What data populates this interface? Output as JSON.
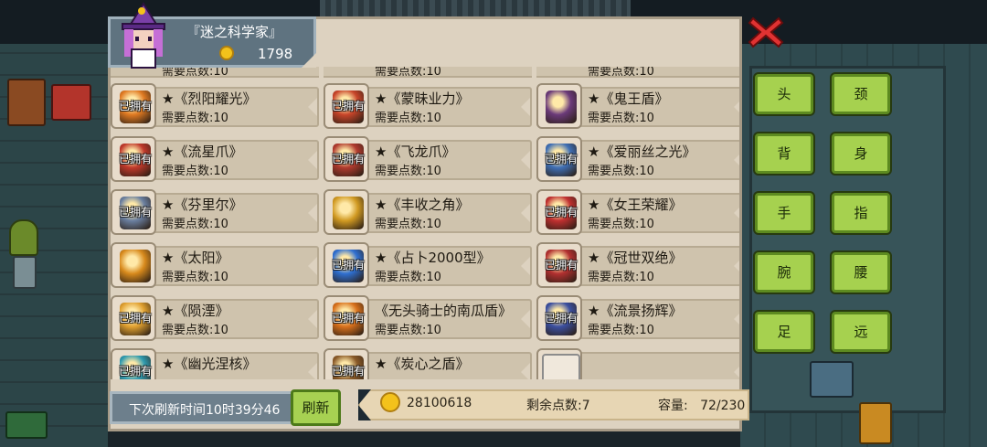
{
  "header": {
    "title": "『迷之科学家』",
    "coins": "1798",
    "avatar_icon": "wizard-avatar-icon"
  },
  "close_icon": "close-x-icon",
  "owned_label": "已拥有",
  "partial_top": [
    "需要点数:10",
    "需要点数:10",
    "需要点数:10"
  ],
  "items": [
    {
      "name": "★《烈阳耀光》",
      "cost": "需要点数:10",
      "owned": true,
      "icon": "flame-spear-icon",
      "color": "#e07a22"
    },
    {
      "name": "★《蒙昧业力》",
      "cost": "需要点数:10",
      "owned": true,
      "icon": "fire-staff-icon",
      "color": "#c8452a"
    },
    {
      "name": "★《鬼王盾》",
      "cost": "需要点数:10",
      "owned": false,
      "icon": "demon-shield-icon",
      "color": "#6b3a7a"
    },
    {
      "name": "★《流星爪》",
      "cost": "需要点数:10",
      "owned": true,
      "icon": "meteor-claw-icon",
      "color": "#c0392b"
    },
    {
      "name": "★《飞龙爪》",
      "cost": "需要点数:10",
      "owned": true,
      "icon": "dragon-claw-icon",
      "color": "#b03a2e"
    },
    {
      "name": "★《爱丽丝之光》",
      "cost": "需要点数:10",
      "owned": true,
      "icon": "alice-light-icon",
      "color": "#3f6fb5"
    },
    {
      "name": "★《芬里尔》",
      "cost": "需要点数:10",
      "owned": true,
      "icon": "wolf-gauntlet-icon",
      "color": "#6a7fa0"
    },
    {
      "name": "★《丰收之角》",
      "cost": "需要点数:10",
      "owned": false,
      "icon": "horn-icon",
      "color": "#d19a22"
    },
    {
      "name": "★《女王荣耀》",
      "cost": "需要点数:10",
      "owned": true,
      "icon": "queen-shield-icon",
      "color": "#c03030"
    },
    {
      "name": "★《太阳》",
      "cost": "需要点数:10",
      "owned": false,
      "icon": "sun-shield-icon",
      "color": "#d88a1c"
    },
    {
      "name": "★《占卜2000型》",
      "cost": "需要点数:10",
      "owned": true,
      "icon": "crystal-ball-icon",
      "color": "#2e6fd1"
    },
    {
      "name": "★《冠世双绝》",
      "cost": "需要点数:10",
      "owned": true,
      "icon": "twin-crown-icon",
      "color": "#b23030"
    },
    {
      "name": "★《陨湮》",
      "cost": "需要点数:10",
      "owned": true,
      "icon": "comet-blade-icon",
      "color": "#e0a030"
    },
    {
      "name": "《无头骑士的南瓜盾》",
      "cost": "需要点数:10",
      "owned": true,
      "icon": "pumpkin-shield-icon",
      "color": "#d8701c"
    },
    {
      "name": "★《流景扬辉》",
      "cost": "需要点数:10",
      "owned": true,
      "icon": "radiant-shield-icon",
      "color": "#3b4fa0"
    }
  ],
  "partial_bottom": [
    {
      "name": "★《幽光涅核》",
      "owned": true,
      "icon": "glow-core-icon",
      "color": "#2f9bb0"
    },
    {
      "name": "★《炭心之盾》",
      "owned": true,
      "icon": "ember-shield-icon",
      "color": "#8a5a28"
    },
    {
      "name": "",
      "owned": false,
      "icon": "empty-slot-icon",
      "color": "#f0e8dc"
    }
  ],
  "footer": {
    "refresh_time": "下次刷新时间10时39分46",
    "refresh_button": "刷新",
    "total_coins": "28100618",
    "remaining_points": "剩余点数:7",
    "capacity": "容量:   72/230"
  },
  "slots": [
    {
      "label": "头",
      "name": "slot-head-button"
    },
    {
      "label": "颈",
      "name": "slot-neck-button"
    },
    {
      "label": "背",
      "name": "slot-back-button"
    },
    {
      "label": "身",
      "name": "slot-body-button"
    },
    {
      "label": "手",
      "name": "slot-hand-button"
    },
    {
      "label": "指",
      "name": "slot-finger-button"
    },
    {
      "label": "腕",
      "name": "slot-wrist-button"
    },
    {
      "label": "腰",
      "name": "slot-waist-button"
    },
    {
      "label": "足",
      "name": "slot-foot-button"
    },
    {
      "label": "远",
      "name": "slot-ranged-button"
    }
  ]
}
